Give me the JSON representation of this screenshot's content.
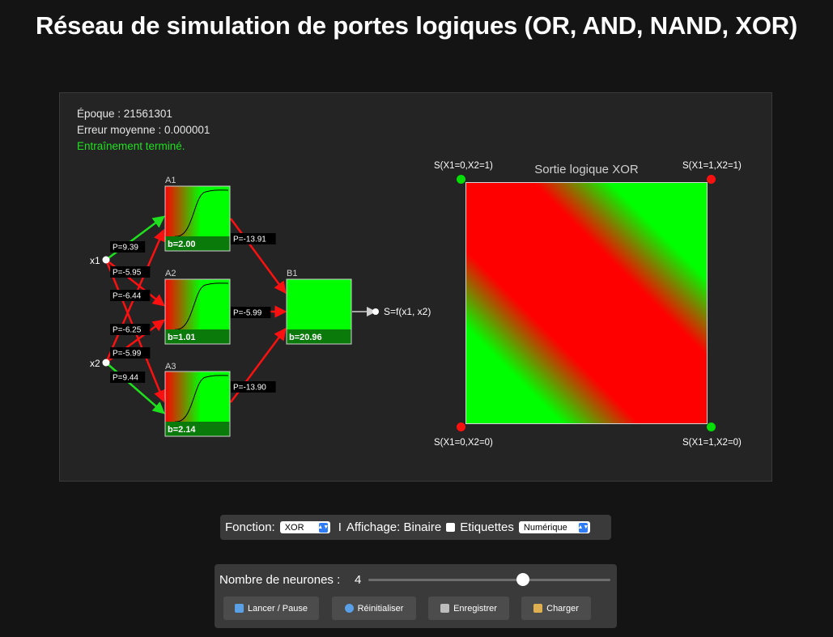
{
  "title": "Réseau de simulation de portes logiques (OR, AND, NAND, XOR)",
  "stats": {
    "epoch": "Époque : 21561301",
    "error": "Erreur moyenne : 0.000001",
    "status": "Entraînement terminé.",
    "status_color": "#1fe01f"
  },
  "network": {
    "inputs": [
      "x1",
      "x2"
    ],
    "output_label": "S=f(x1, x2)",
    "neurons": [
      {
        "name": "A1",
        "bias": "b=2.00"
      },
      {
        "name": "A2",
        "bias": "b=1.01"
      },
      {
        "name": "A3",
        "bias": "b=2.14"
      },
      {
        "name": "B1",
        "bias": "b=20.96"
      }
    ],
    "weights": [
      {
        "label": "P=9.39",
        "from": "x1",
        "to": "A1",
        "color": "#1fe01f"
      },
      {
        "label": "P=-5.95",
        "from": "x1",
        "to": "A2",
        "color": "#ff1010"
      },
      {
        "label": "P=-6.44",
        "from": "x1",
        "to": "A3",
        "color": "#ff1010"
      },
      {
        "label": "P=-6.25",
        "from": "x2",
        "to": "A1",
        "color": "#ff1010"
      },
      {
        "label": "P=-5.99",
        "from": "x2",
        "to": "A2",
        "color": "#ff1010"
      },
      {
        "label": "P=9.44",
        "from": "x2",
        "to": "A3",
        "color": "#1fe01f"
      },
      {
        "label": "P=-13.91",
        "from": "A1",
        "to": "B1",
        "color": "#ff1010"
      },
      {
        "label": "P=-5.99",
        "from": "A2",
        "to": "B1",
        "color": "#ff1010"
      },
      {
        "label": "P=-13.90",
        "from": "A3",
        "to": "B1",
        "color": "#ff1010"
      }
    ]
  },
  "output_plot": {
    "title": "Sortie logique XOR",
    "corners": [
      {
        "label": "S(X1=0,X2=1)",
        "color": "#00dd00"
      },
      {
        "label": "S(X1=1,X2=1)",
        "color": "#ff1010"
      },
      {
        "label": "S(X1=0,X2=0)",
        "color": "#ff1010"
      },
      {
        "label": "S(X1=1,X2=0)",
        "color": "#00dd00"
      }
    ]
  },
  "controls": {
    "function_label": "Fonction:",
    "function_value": "XOR",
    "separator": "I",
    "display_label": "Affichage: Binaire",
    "labels_label": "Etiquettes",
    "labels_value": "Numérique",
    "neurons_label": "Nombre de neurones :",
    "neurons_value": "4",
    "neurons_slider_fraction": 0.64,
    "buttons": {
      "run": "Lancer / Pause",
      "reset": "Réinitialiser",
      "save": "Enregistrer",
      "load": "Charger"
    }
  }
}
